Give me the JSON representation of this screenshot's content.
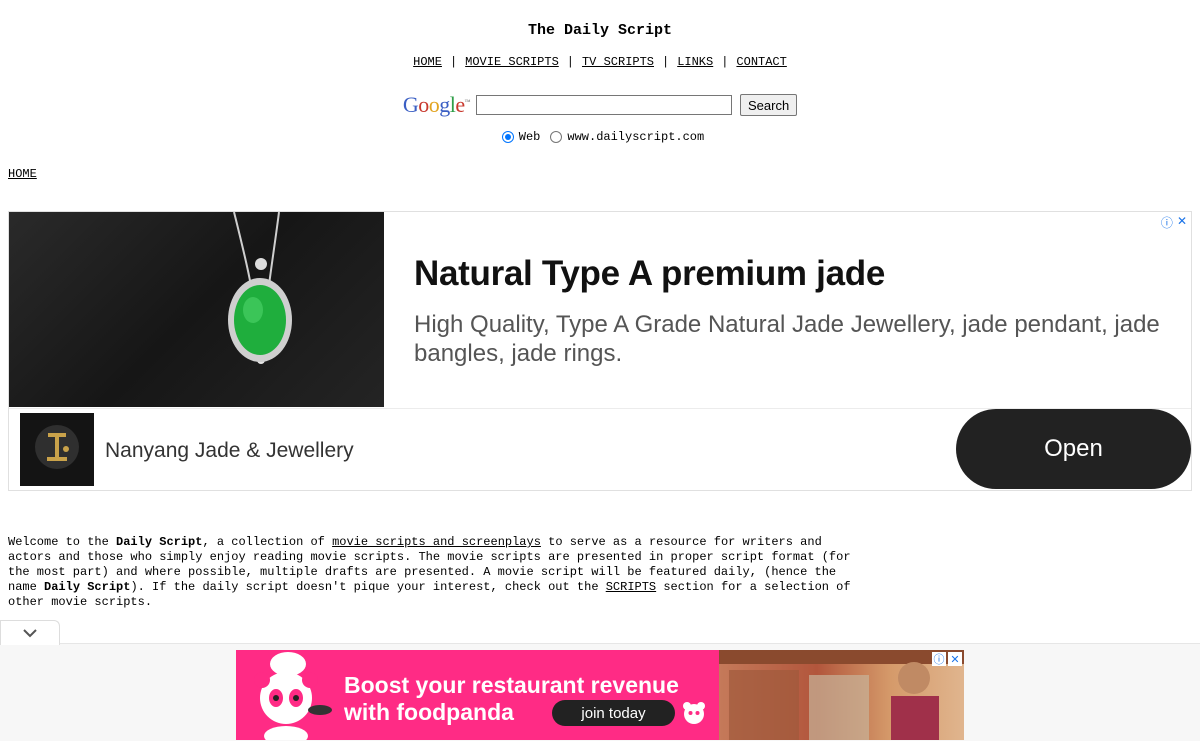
{
  "site": {
    "title": "The Daily Script"
  },
  "nav": {
    "items": [
      "HOME",
      "MOVIE SCRIPTS",
      "TV SCRIPTS",
      "LINKS",
      "CONTACT"
    ]
  },
  "search": {
    "logo": "Google",
    "value": "",
    "button": "Search",
    "options": [
      {
        "label": "Web",
        "checked": true
      },
      {
        "label": "www.dailyscript.com",
        "checked": false
      }
    ]
  },
  "breadcrumb": {
    "home": "HOME"
  },
  "ad_top": {
    "headline": "Natural Type A premium jade",
    "description": "High Quality, Type A Grade Natural Jade Jewellery, jade pendant, jade bangles, jade rings.",
    "advertiser": "Nanyang Jade & Jewellery",
    "cta": "Open"
  },
  "intro": {
    "p1": "Welcome to the ",
    "brand1": "Daily Script",
    "p2": ", a collection of ",
    "link1": "movie scripts and screenplays",
    "p3": " to serve as a resource for writers and actors and those who simply enjoy reading movie scripts. The movie scripts are presented in proper script format (for the most part) and where possible, multiple drafts are presented. A movie script will be featured daily, (hence the name ",
    "brand2": "Daily Script",
    "p4": "). If the daily script doesn't pique your interest, check out the ",
    "link2": "SCRIPTS",
    "p5": " section for a selection of other movie scripts."
  },
  "ad_bottom": {
    "line1": "Boost your restaurant revenue",
    "line2": "with foodpanda",
    "cta": "join today"
  },
  "colors": {
    "ad_bottom_bg": "#ff2b85",
    "open_button": "#222222",
    "radio_accent": "#0075ff"
  }
}
